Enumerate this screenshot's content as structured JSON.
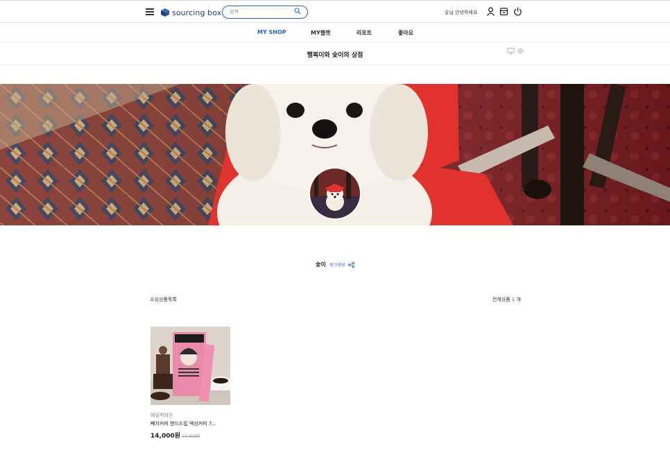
{
  "header": {
    "logo_text": "sourcing box",
    "search_placeholder": "검색",
    "greeting": "숯님 안녕하세요."
  },
  "nav": {
    "items": [
      {
        "label": "MY SHOP",
        "active": true
      },
      {
        "label": "MY웹렛",
        "active": false
      },
      {
        "label": "리포트",
        "active": false
      },
      {
        "label": "좋아요",
        "active": false
      }
    ]
  },
  "shop": {
    "title": "행복이와 숯이의 상점",
    "nickname": "숯이",
    "link_label": "링크생성"
  },
  "listing": {
    "title": "소싱상품목록",
    "total_label": "전체상품",
    "total_count": "1",
    "total_unit": "개"
  },
  "products": [
    {
      "brand": "해밀백화전",
      "name": "빼지커피 핸드드립 액상커피 7...",
      "price": "14,000원",
      "original_price": "14,000원"
    }
  ],
  "colors": {
    "accent": "#2a63b5",
    "brand_navy": "#1f3f73"
  }
}
